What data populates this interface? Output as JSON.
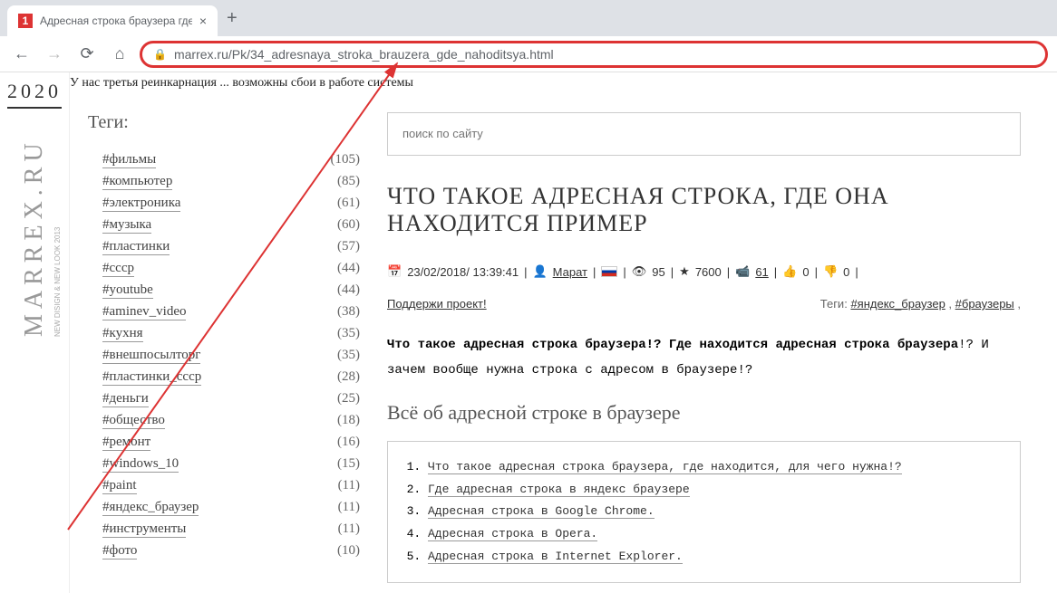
{
  "browser": {
    "tab_title": "Адресная строка браузера где",
    "url": "marrex.ru/Pk/34_adresnaya_stroka_brauzera_gde_nahoditsya.html"
  },
  "site": {
    "year": "2020",
    "logo": "MARREX.RU",
    "sublogo": "NEW DISIGN & NEW LOOK 2013",
    "notice": "У нас третья реинкарнация ... возможны сбои в работе системы"
  },
  "sidebar": {
    "title": "Теги:",
    "tags": [
      {
        "name": "#фильмы",
        "count": "(105)"
      },
      {
        "name": "#компьютер",
        "count": "(85)"
      },
      {
        "name": "#электроника",
        "count": "(61)"
      },
      {
        "name": "#музыка",
        "count": "(60)"
      },
      {
        "name": "#пластинки",
        "count": "(57)"
      },
      {
        "name": "#ссср",
        "count": "(44)"
      },
      {
        "name": "#youtube",
        "count": "(44)"
      },
      {
        "name": "#aminev_video",
        "count": "(38)"
      },
      {
        "name": "#кухня",
        "count": "(35)"
      },
      {
        "name": "#внешпосылторг",
        "count": "(35)"
      },
      {
        "name": "#пластинки_ссср",
        "count": "(28)"
      },
      {
        "name": "#деньги",
        "count": "(25)"
      },
      {
        "name": "#общество",
        "count": "(18)"
      },
      {
        "name": "#ремонт",
        "count": "(16)"
      },
      {
        "name": "#windows_10",
        "count": "(15)"
      },
      {
        "name": "#paint",
        "count": "(11)"
      },
      {
        "name": "#яндекс_браузер",
        "count": "(11)"
      },
      {
        "name": "#инструменты",
        "count": "(11)"
      },
      {
        "name": "#фото",
        "count": "(10)"
      }
    ]
  },
  "search": {
    "placeholder": "поиск по сайту"
  },
  "article": {
    "title": "ЧТО ТАКОЕ АДРЕСНАЯ СТРОКА, ГДЕ ОНА НАХОДИТСЯ ПРИМЕР",
    "date": "23/02/2018/ 13:39:41",
    "author": "Марат",
    "views": "95",
    "stars": "7600",
    "video": "61",
    "thumbs_up": "0",
    "thumbs_down": "0",
    "support": "Поддержи проект!",
    "tags_label": "Теги:",
    "tag1": "#яндекс_браузер",
    "tag2": "#браузеры",
    "body_bold1": "Что такое адресная строка браузера!? Где находится адресная строка браузера",
    "body_rest": "!? И зачем вообще нужна строка с адресом в браузере!?",
    "section": "Всё об адресной строке в браузере",
    "toc": [
      "Что такое адресная строка браузера, где находится, для чего нужна!?",
      "Где адресная строка в яндекс браузере",
      "Адресная строка в Google Chrome.",
      "Адресная строка в Opera.",
      "Адресная строка в Internet Explorer."
    ]
  }
}
